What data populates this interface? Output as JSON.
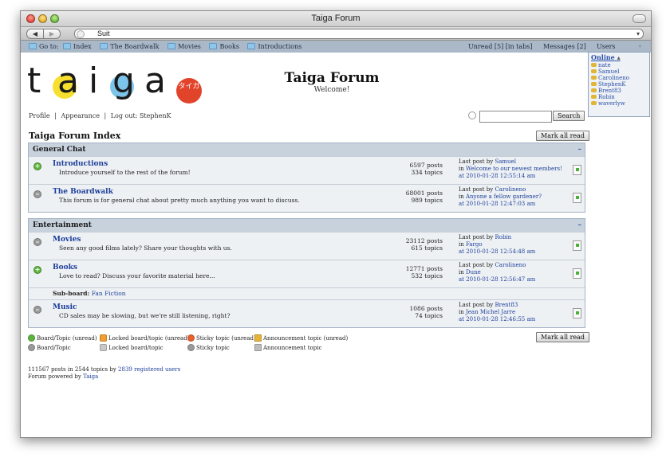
{
  "window": {
    "title": "Taiga Forum"
  },
  "browser": {
    "address": "Suit",
    "back_label": "◀",
    "forward_label": "▶"
  },
  "forumbar": {
    "goto_label": "Go to:",
    "links": [
      "Index",
      "The Boardwalk",
      "Movies",
      "Books",
      "Introductions"
    ],
    "unread": "Unread [5] [in tabs]",
    "messages": "Messages [2]",
    "users": "Users"
  },
  "users_panel": {
    "online_label": "Online",
    "users": [
      "nate",
      "Samuel",
      "Carolineno",
      "StephenK",
      "Brent83",
      "Robin",
      "waverlyw"
    ]
  },
  "header": {
    "logo_text": "taiga",
    "logo_badge": "タイガ",
    "title": "Taiga Forum",
    "subtitle": "Welcome!"
  },
  "usermenu": {
    "profile": "Profile",
    "sep": "|",
    "appearance": "Appearance",
    "logout": "Log out: StephenK"
  },
  "search": {
    "button": "Search",
    "placeholder": ""
  },
  "page": {
    "title": "Taiga Forum Index",
    "mark_all_read": "Mark all read"
  },
  "categories": [
    {
      "name": "General Chat",
      "collapse": "–",
      "boards": [
        {
          "name": "Introductions",
          "desc": "Introduce yourself to the rest of the forum!",
          "posts": "6597 posts",
          "topics": "334 topics",
          "last_by": "Samuel",
          "last_in": "Welcome to our newest members!",
          "last_at": "at 2010-01-28 12:55:14 am",
          "state": "unread"
        },
        {
          "name": "The Boardwalk",
          "desc": "This forum is for general chat about pretty much anything you want to discuss.",
          "posts": "68001 posts",
          "topics": "989 topics",
          "last_by": "Carolineno",
          "last_in": "Anyone a fellow gardener?",
          "last_at": "at 2010-01-28 12:47:03 am",
          "state": "read"
        }
      ]
    },
    {
      "name": "Entertainment",
      "collapse": "–",
      "boards": [
        {
          "name": "Movies",
          "desc": "Seen any good films lately? Share your thoughts with us.",
          "posts": "23112 posts",
          "topics": "615 topics",
          "last_by": "Robin",
          "last_in": "Fargo",
          "last_at": "at 2010-01-28 12:54:48 am",
          "state": "read"
        },
        {
          "name": "Books",
          "desc": "Love to read? Discuss your favorite material here...",
          "posts": "12771 posts",
          "topics": "532 topics",
          "last_by": "Carolineno",
          "last_in": "Dune",
          "last_at": "at 2010-01-28 12:56:47 am",
          "state": "unread",
          "subboard_label": "Sub-board:",
          "subboard": "Fan Fiction"
        },
        {
          "name": "Music",
          "desc": "CD sales may be slowing, but we're still listening, right?",
          "posts": "1086 posts",
          "topics": "74 topics",
          "last_by": "Brent83",
          "last_in": "Jean Michel Jarre",
          "last_at": "at 2010-01-28 12:46:55 am",
          "state": "read"
        }
      ]
    }
  ],
  "labels": {
    "last_post_by": "Last post by",
    "in": "in"
  },
  "legend": {
    "board_unread": "Board/Topic (unread)",
    "board": "Board/Topic",
    "locked_unread": "Locked board/topic (unread)",
    "locked": "Locked board/topic",
    "sticky_unread": "Sticky topic (unread)",
    "sticky": "Sticky topic",
    "announce_unread": "Announcement topic (unread)",
    "announce": "Announcement topic"
  },
  "footer": {
    "stats_prefix": "111567 posts in 2544 topics by",
    "stats_link": "2839 registered users",
    "powered_prefix": "Forum powered by",
    "powered_link": "Taiga"
  },
  "colors": {
    "link": "#1c3f9a",
    "unread_green": "#5cb43c",
    "read_gray": "#9a9a9a",
    "category_bg": "#c8d2dd"
  }
}
